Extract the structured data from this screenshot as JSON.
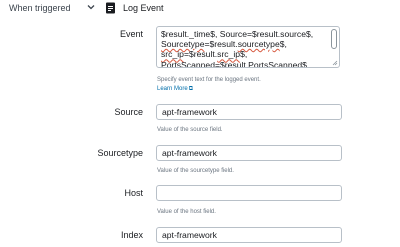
{
  "trigger": {
    "label": "When triggered",
    "expand_icon": "chevron-down-icon"
  },
  "action": {
    "icon": "log-event-icon",
    "title": "Log Event"
  },
  "fields": {
    "event": {
      "label": "Event",
      "lines": [
        {
          "pre": "$result._time$, Source=$result.source$,",
          "sq": "",
          "post": ""
        },
        {
          "pre": "",
          "sq": "Sourcetype",
          "post": "=$result.",
          "sq2": "sourcetype",
          "post2": "$,"
        },
        {
          "pre": "",
          "sq": "src_ip",
          "post": "=$result.",
          "sq2": "src_ip",
          "post2": "$,"
        },
        {
          "pre": "PortsScanned=$result.PortsScanned$.",
          "sq": "",
          "post": ""
        }
      ],
      "help": "Specify event text for the logged event.",
      "learn_more": "Learn More"
    },
    "source": {
      "label": "Source",
      "value": "apt-framework",
      "help": "Value of the source field."
    },
    "sourcetype": {
      "label": "Sourcetype",
      "value": "apt-framework",
      "help": "Value of the sourcetype field."
    },
    "host": {
      "label": "Host",
      "value": "",
      "help": "Value of the host field."
    },
    "index": {
      "label": "Index",
      "value": "apt-framework"
    }
  }
}
